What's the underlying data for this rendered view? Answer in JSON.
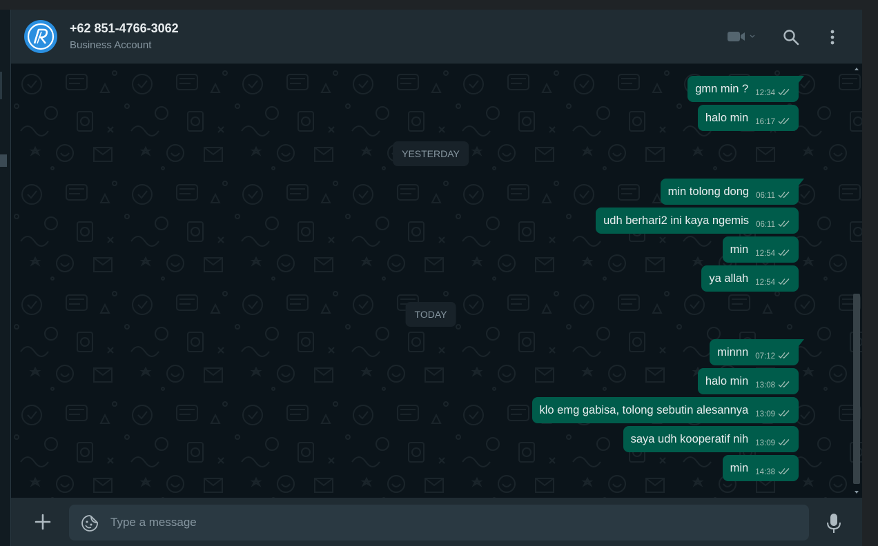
{
  "header": {
    "contact_name": "+62 851-4766-3062",
    "contact_status": "Business Account",
    "icons": [
      "video-call-icon",
      "search-icon",
      "menu-icon"
    ]
  },
  "colors": {
    "bubble_out": "#005c4b",
    "header_bg": "#202c33",
    "chat_bg": "#0b141a",
    "avatar_bg": "#2a8fe0"
  },
  "date_chips": [
    "YESTERDAY",
    "TODAY"
  ],
  "messages": [
    {
      "text": "gmn min ?",
      "time": "12:34",
      "status": "read"
    },
    {
      "text": "halo min",
      "time": "16:17",
      "status": "read"
    },
    {
      "text": "min tolong dong",
      "time": "06:11",
      "status": "read"
    },
    {
      "text": "udh berhari2 ini kaya ngemis",
      "time": "06:11",
      "status": "read"
    },
    {
      "text": "min",
      "time": "12:54",
      "status": "read"
    },
    {
      "text": "ya allah",
      "time": "12:54",
      "status": "read"
    },
    {
      "text": "minnn",
      "time": "07:12",
      "status": "read"
    },
    {
      "text": "halo min",
      "time": "13:08",
      "status": "read"
    },
    {
      "text": "klo emg gabisa, tolong sebutin alesannya",
      "time": "13:09",
      "status": "read"
    },
    {
      "text": "saya udh kooperatif nih",
      "time": "13:09",
      "status": "read"
    },
    {
      "text": "min",
      "time": "14:38",
      "status": "read"
    }
  ],
  "composer": {
    "placeholder": "Type a message"
  }
}
